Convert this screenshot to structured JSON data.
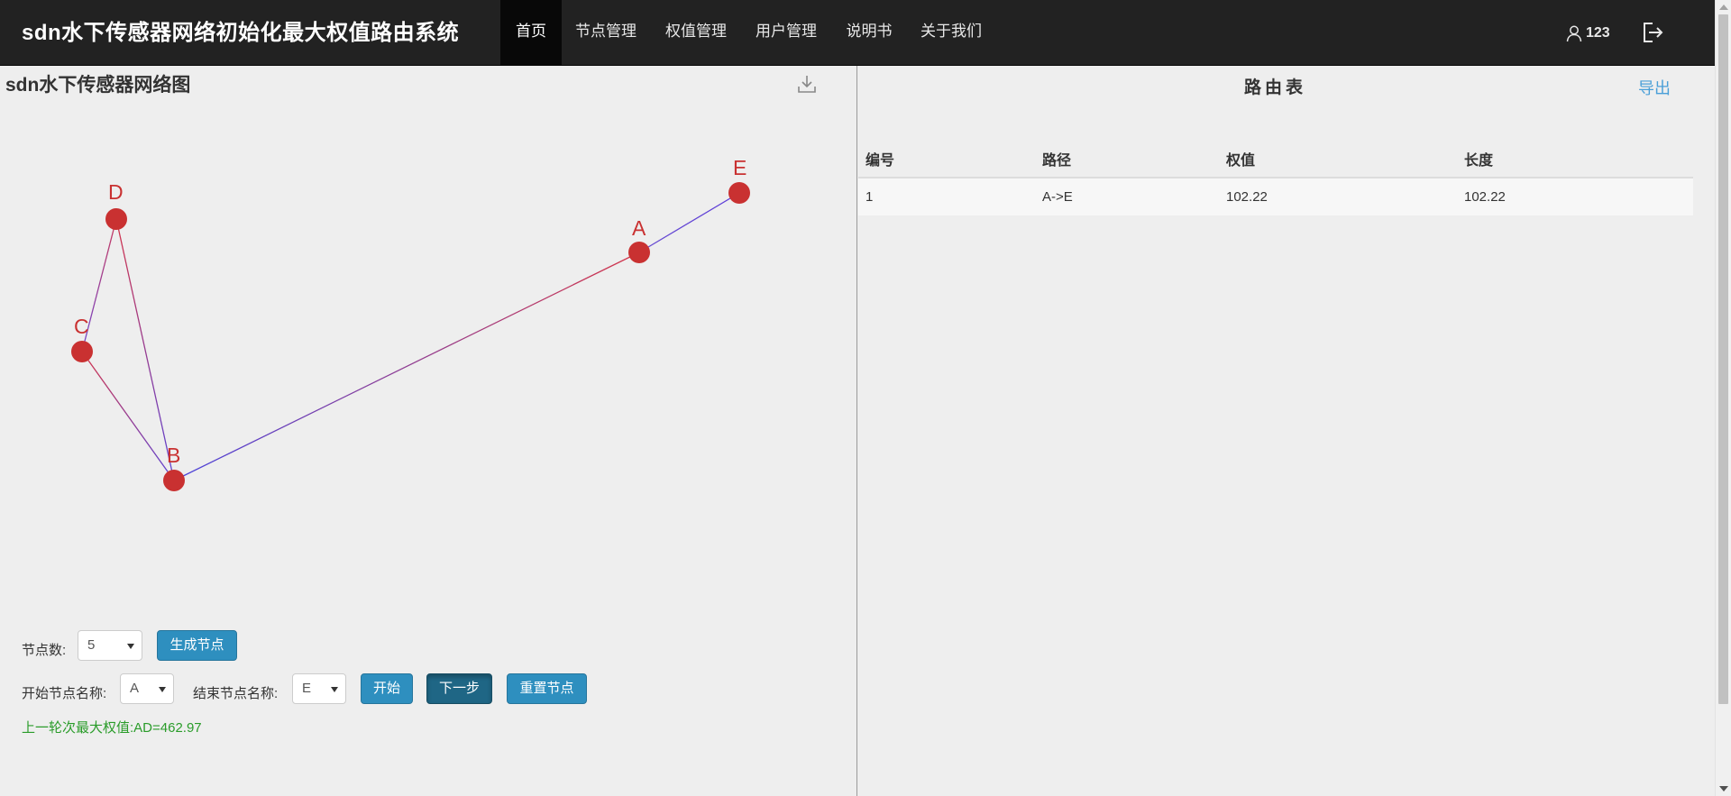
{
  "navbar": {
    "brand": "sdn水下传感器网络初始化最大权值路由系统",
    "items": [
      {
        "label": "首页",
        "active": true
      },
      {
        "label": "节点管理",
        "active": false
      },
      {
        "label": "权值管理",
        "active": false
      },
      {
        "label": "用户管理",
        "active": false
      },
      {
        "label": "说明书",
        "active": false
      },
      {
        "label": "关于我们",
        "active": false
      }
    ],
    "user": {
      "icon": "user-icon",
      "name": "123"
    },
    "logout_icon": "logout-icon"
  },
  "graph": {
    "title": "sdn水下传感器网络图",
    "download_icon": "download-icon",
    "node_color": "#c93131",
    "nodes": [
      "A",
      "B",
      "C",
      "D",
      "E"
    ],
    "edges": [
      [
        "A",
        "E"
      ],
      [
        "A",
        "B"
      ],
      [
        "B",
        "C"
      ],
      [
        "B",
        "D"
      ],
      [
        "C",
        "D"
      ]
    ]
  },
  "controls": {
    "node_count_label": "节点数:",
    "node_count_value": "5",
    "generate_button": "生成节点",
    "start_label": "开始节点名称:",
    "start_value": "A",
    "end_label": "结束节点名称:",
    "end_value": "E",
    "start_button": "开始",
    "next_button": "下一步",
    "reset_button": "重置节点",
    "result_text": "上一轮次最大权值:AD=462.97"
  },
  "route_table": {
    "title": "路由表",
    "export_label": "导出",
    "columns": [
      "编号",
      "路径",
      "权值",
      "长度"
    ],
    "rows": [
      [
        "1",
        "A->E",
        "102.22",
        "102.22"
      ]
    ]
  },
  "colors": {
    "navbar_bg": "#222222",
    "accent_button": "#2e8fbf",
    "link": "#4a9fd8",
    "result_green": "#2a9c2a"
  }
}
